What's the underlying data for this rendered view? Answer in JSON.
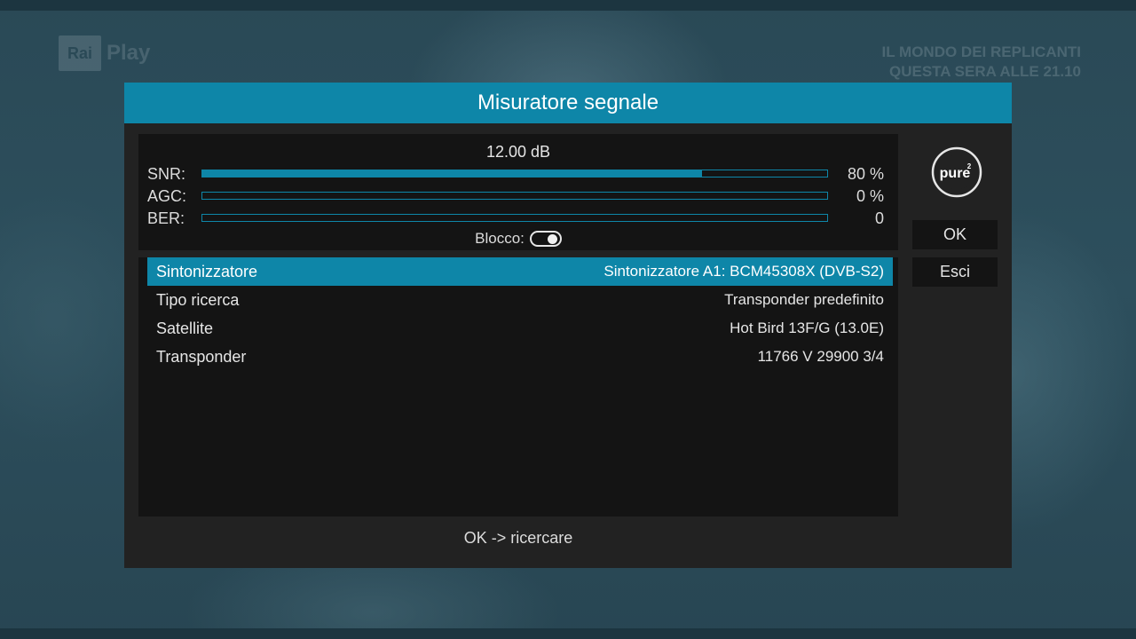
{
  "background": {
    "channel_logo_mark": "Rai",
    "channel_logo_text": "Play",
    "promo_line1": "IL MONDO DEI REPLICANTI",
    "promo_line2": "QUESTA SERA ALLE 21.10"
  },
  "dialog": {
    "title": "Misuratore segnale",
    "signal": {
      "db": "12.00 dB",
      "meters": [
        {
          "label": "SNR:",
          "value": "80 %",
          "fill_percent": 80
        },
        {
          "label": "AGC:",
          "value": "0 %",
          "fill_percent": 0
        },
        {
          "label": "BER:",
          "value": "0",
          "fill_percent": 0
        }
      ],
      "lock_label": "Blocco:",
      "lock_on": true
    },
    "settings": [
      {
        "key": "Sintonizzatore",
        "value": "Sintonizzatore A1: BCM45308X (DVB-S2)",
        "selected": true
      },
      {
        "key": "Tipo ricerca",
        "value": "Transponder predefinito",
        "selected": false
      },
      {
        "key": "Satellite",
        "value": "Hot Bird 13F/G (13.0E)",
        "selected": false
      },
      {
        "key": "Transponder",
        "value": "11766 V 29900 3/4",
        "selected": false
      }
    ],
    "hint": "OK -> ricercare",
    "brand_logo_icon": "pure2-logo-icon",
    "brand_logo_text": "pure",
    "brand_logo_superscript": "2",
    "buttons": {
      "ok": "OK",
      "exit": "Esci"
    }
  },
  "colors": {
    "accent": "#0e86a8",
    "dialog_bg": "#222222",
    "panel_bg": "#141414"
  }
}
